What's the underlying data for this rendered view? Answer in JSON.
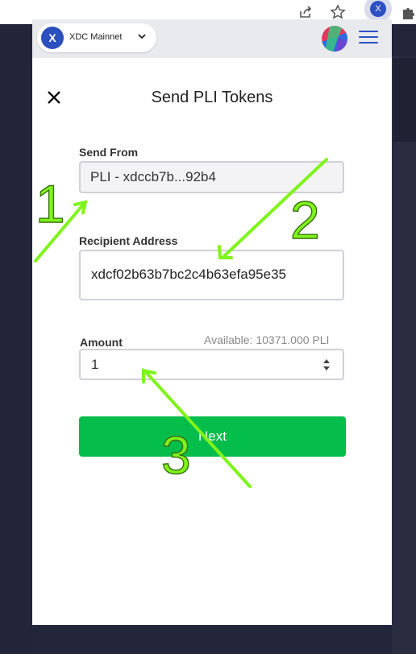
{
  "browser": {
    "icons": [
      "share-icon",
      "star-icon",
      "extension-icon",
      "puzzle-icon"
    ],
    "extension_badge": "X"
  },
  "header": {
    "network_logo": "X",
    "network_name": "XDC Mainnet"
  },
  "page": {
    "title": "Send PLI Tokens"
  },
  "form": {
    "send_from_label": "Send From",
    "send_from_value": "PLI - xdccb7b...92b4",
    "recipient_label": "Recipient Address",
    "recipient_value": "xdcf02b63b7bc2c4b63efa95e35",
    "amount_label": "Amount",
    "available_text": "Available: 10371.000  PLI",
    "amount_value": "1",
    "next_label": "Next"
  },
  "annotations": {
    "numbers": [
      "1",
      "2",
      "3"
    ],
    "color": "#7ff41c"
  },
  "colors": {
    "accent_green": "#04bd4a",
    "brand_blue": "#2c4fbe",
    "background": "#23263a"
  }
}
